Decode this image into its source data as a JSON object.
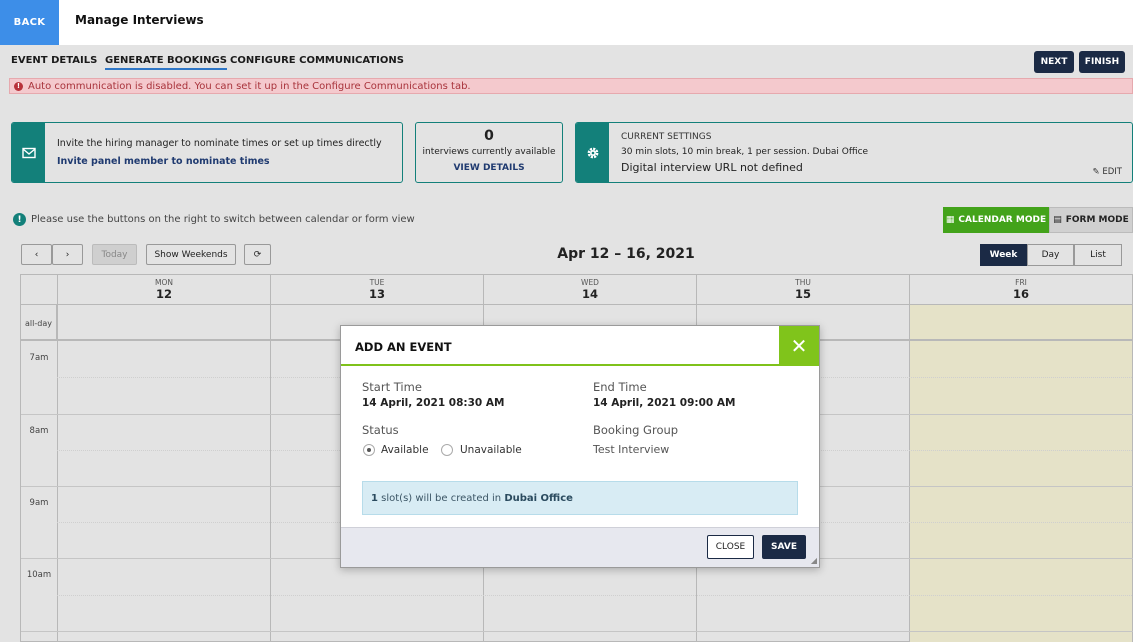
{
  "header": {
    "back_label": "BACK",
    "title": "Manage Interviews"
  },
  "tabs": [
    {
      "label": "EVENT DETAILS",
      "active": false
    },
    {
      "label": "GENERATE BOOKINGS",
      "active": true
    },
    {
      "label": "CONFIGURE COMMUNICATIONS",
      "active": false
    }
  ],
  "actions": {
    "next_label": "NEXT",
    "finish_label": "FINISH"
  },
  "alert": {
    "text": "Auto communication is disabled. You can set it up in the Configure Communications tab."
  },
  "cards": {
    "invite": {
      "text": "Invite the hiring manager to nominate times or set up times directly",
      "link": "Invite panel member to nominate times"
    },
    "interviews": {
      "count": "0",
      "text": "interviews currently available",
      "link": "VIEW DETAILS"
    },
    "settings": {
      "heading": "CURRENT SETTINGS",
      "line1": "30 min slots, 10 min break, 1 per session. Dubai Office",
      "line2": "Digital interview URL not defined",
      "edit_label": "EDIT"
    }
  },
  "hint": {
    "text": "Please use the buttons on the right to switch between calendar or form view"
  },
  "modes": {
    "calendar_label": "CALENDAR MODE",
    "form_label": "FORM MODE",
    "active": "calendar"
  },
  "calendar": {
    "prev_icon": "‹",
    "next_icon": "›",
    "today_label": "Today",
    "weekends_label": "Show Weekends",
    "range": "Apr 12 – 16, 2021",
    "views": [
      {
        "label": "Week",
        "active": true
      },
      {
        "label": "Day",
        "active": false
      },
      {
        "label": "List",
        "active": false
      }
    ],
    "days": [
      {
        "dow": "MON",
        "num": "12"
      },
      {
        "dow": "TUE",
        "num": "13"
      },
      {
        "dow": "WED",
        "num": "14"
      },
      {
        "dow": "THU",
        "num": "15"
      },
      {
        "dow": "FRI",
        "num": "16"
      }
    ],
    "allday_label": "all-day",
    "times": [
      "7am",
      "8am",
      "9am",
      "10am"
    ]
  },
  "modal": {
    "title": "ADD AN EVENT",
    "close_icon": "✕",
    "start_label": "Start Time",
    "start_value": "14 April, 2021 08:30 AM",
    "end_label": "End Time",
    "end_value": "14 April, 2021 09:00 AM",
    "status_label": "Status",
    "status_options": [
      "Available",
      "Unavailable"
    ],
    "status_selected": "Available",
    "group_label": "Booking Group",
    "group_value": "Test Interview",
    "info_count": "1",
    "info_text": " slot(s) will be created in ",
    "info_location": "Dubai Office",
    "close_label": "CLOSE",
    "save_label": "SAVE"
  },
  "colors": {
    "accent_teal": "#13807a",
    "accent_green": "#43a31a",
    "navy": "#1b2a45",
    "back_blue": "#3d8ee8"
  }
}
